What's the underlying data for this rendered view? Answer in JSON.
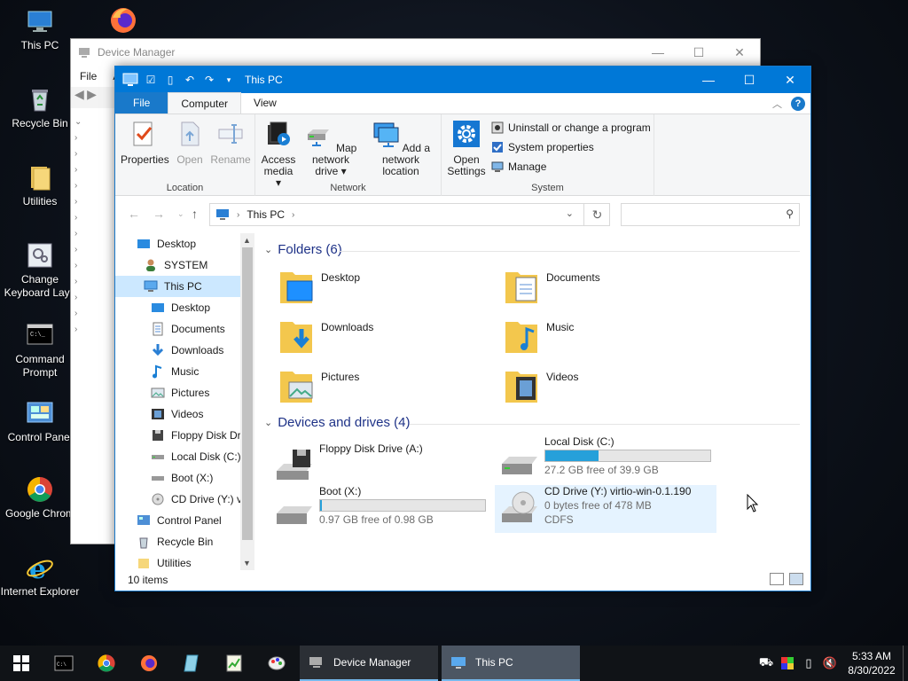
{
  "desktop": {
    "icons": [
      {
        "label": "This PC",
        "icon": "this-pc-icon"
      },
      {
        "label": "Recycle Bin",
        "icon": "recycle-bin-icon"
      },
      {
        "label": "Utilities",
        "icon": "folder-icon"
      },
      {
        "label": "Change Keyboard Layo",
        "label2": "Change",
        "icon": "keyboard-settings-icon"
      },
      {
        "label": "Command Prompt",
        "icon": "command-prompt-icon"
      },
      {
        "label": "Control Panel",
        "icon": "control-panel-icon"
      },
      {
        "label": "Google Chrom",
        "icon": "chrome-icon"
      },
      {
        "label": "Internet Explorer",
        "icon": "ie-icon"
      }
    ],
    "firefox_label": ""
  },
  "device_manager": {
    "title": "Device Manager",
    "menu": [
      "File",
      "A"
    ]
  },
  "explorer": {
    "title": "This PC",
    "tabs": {
      "file": "File",
      "computer": "Computer",
      "view": "View"
    },
    "ribbon": {
      "location": {
        "label": "Location",
        "properties": "Properties",
        "open": "Open",
        "rename": "Rename"
      },
      "network": {
        "label": "Network",
        "access_media": "Access",
        "access_media2": "media ▾",
        "map_drive": "Map network",
        "map_drive2": "drive ▾",
        "add_location": "Add a network",
        "add_location2": "location"
      },
      "system": {
        "label": "System",
        "open_settings": "Open",
        "open_settings2": "Settings",
        "uninstall": "Uninstall or change a program",
        "system_properties": "System properties",
        "manage": "Manage"
      }
    },
    "address": {
      "path": "This PC",
      "search_placeholder": ""
    },
    "nav": [
      {
        "label": "Desktop",
        "indent": 0
      },
      {
        "label": "SYSTEM",
        "indent": 0
      },
      {
        "label": "This PC",
        "indent": 0,
        "selected": true
      },
      {
        "label": "Desktop",
        "indent": 1
      },
      {
        "label": "Documents",
        "indent": 1
      },
      {
        "label": "Downloads",
        "indent": 1
      },
      {
        "label": "Music",
        "indent": 1
      },
      {
        "label": "Pictures",
        "indent": 1
      },
      {
        "label": "Videos",
        "indent": 1
      },
      {
        "label": "Floppy Disk Dri",
        "indent": 1
      },
      {
        "label": "Local Disk (C:)",
        "indent": 1
      },
      {
        "label": "Boot (X:)",
        "indent": 1
      },
      {
        "label": "CD Drive (Y:) vi",
        "indent": 1
      },
      {
        "label": "Control Panel",
        "indent": 0
      },
      {
        "label": "Recycle Bin",
        "indent": 0
      },
      {
        "label": "Utilities",
        "indent": 0
      }
    ],
    "folders_header": "Folders (6)",
    "folders": [
      {
        "label": "Desktop"
      },
      {
        "label": "Documents"
      },
      {
        "label": "Downloads"
      },
      {
        "label": "Music"
      },
      {
        "label": "Pictures"
      },
      {
        "label": "Videos"
      }
    ],
    "drives_header": "Devices and drives (4)",
    "drives": [
      {
        "label": "Floppy Disk Drive (A:)",
        "free": "",
        "used_fraction": null
      },
      {
        "label": "Local Disk (C:)",
        "free": "27.2 GB free of 39.9 GB",
        "used_fraction": 0.32
      },
      {
        "label": "Boot (X:)",
        "free": "0.97 GB free of 0.98 GB",
        "used_fraction": 0.01
      },
      {
        "label": "CD Drive (Y:) virtio-win-0.1.190",
        "free": "0 bytes free of 478 MB",
        "fs": "CDFS"
      }
    ],
    "status": "10 items"
  },
  "taskbar": {
    "tasks": [
      {
        "label": "Device Manager"
      },
      {
        "label": "This PC"
      }
    ],
    "clock_time": "5:33 AM",
    "clock_date": "8/30/2022"
  }
}
